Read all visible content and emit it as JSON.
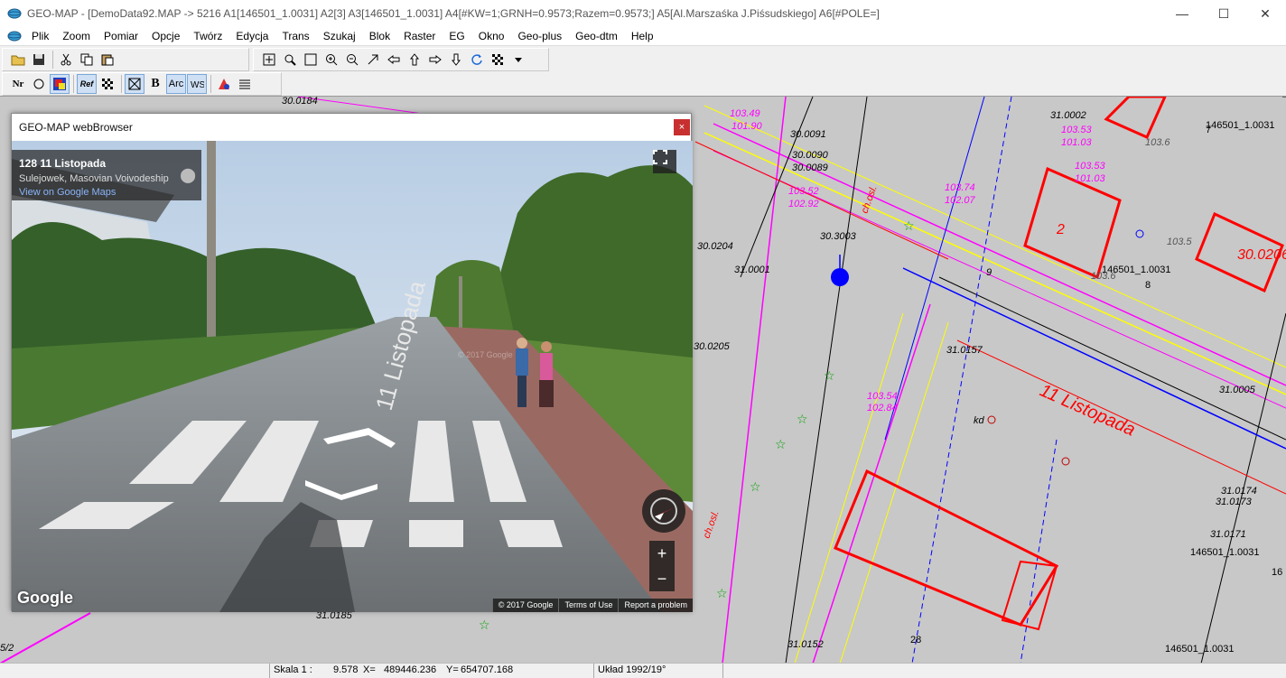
{
  "window": {
    "title": "GEO-MAP - [DemoData92.MAP -> 5216 A1[146501_1.0031]  A2[3]  A3[146501_1.0031]  A4[#KW=1;GRNH=0.9573;Razem=0.9573;]  A5[Al.Marszaśka J.Piśsudskiego]  A6[#POLE=]",
    "minimize": "—",
    "maximize": "☐",
    "close": "✕"
  },
  "menu": {
    "items": [
      "Plik",
      "Zoom",
      "Pomiar",
      "Opcje",
      "Twórz",
      "Edycja",
      "Trans",
      "Szukaj",
      "Blok",
      "Raster",
      "EG",
      "Okno",
      "Geo-plus",
      "Geo-dtm",
      "Help"
    ],
    "mdi_min": "_",
    "mdi_restore": "▫",
    "mdi_close": "×"
  },
  "toolbar": {
    "nr_label": "Nr",
    "ref_label": "Ref",
    "b_label": "B",
    "arc_label": "Arc"
  },
  "map": {
    "labels": [
      "30.0184",
      "103.49",
      "101.90",
      "30.0091",
      "30.0090",
      "30.0089",
      "103.53",
      "31.0002",
      "103.53",
      "101.03",
      "103.6",
      "7",
      "146501_1.0031",
      "103.53",
      "101.03",
      "103.52",
      "102.92",
      "103.74",
      "102.07",
      "2",
      "30.0204",
      "30.3003",
      "103.5",
      "9",
      "31.0001",
      "30.0206",
      "146501_1.0031",
      "8",
      "103.6",
      "31.0157",
      "30.0205",
      "11 Listopada",
      "31.0005",
      "103.54",
      "102.84",
      "kd",
      "31.0174",
      "31.0173",
      "31.0171",
      "146501_1.0031",
      "16",
      "31.0152",
      "28",
      "146501_1.0031",
      "31.0185",
      "5/2",
      "ch.osl.",
      "ch.osl."
    ]
  },
  "browser": {
    "title": "GEO-MAP webBrowser",
    "close": "×",
    "address_title": "128 11 Listopada",
    "address_sub": "Sulejowek, Masovian Voivodeship",
    "maps_link": "View on Google Maps",
    "street_label": "11 Listopada",
    "watermark": "© 2017 Google",
    "google_logo": "Google",
    "zoom_in": "+",
    "zoom_out": "−",
    "footer": [
      "© 2017 Google",
      "Terms of Use",
      "Report a problem"
    ]
  },
  "status": {
    "scale_label": "Skala 1 :",
    "scale_value": "9.578",
    "x_label": "X=",
    "x_value": "489446.236",
    "y_label": "Y=",
    "y_value": "654707.168",
    "crs": "Układ 1992/19°"
  },
  "colors": {
    "map_bg": "#c8c8c8",
    "building": "#ff0000",
    "parcel": "#ff00ff",
    "road": "#ffff00",
    "utility": "#0000ff",
    "vegetation": "#00a000"
  }
}
